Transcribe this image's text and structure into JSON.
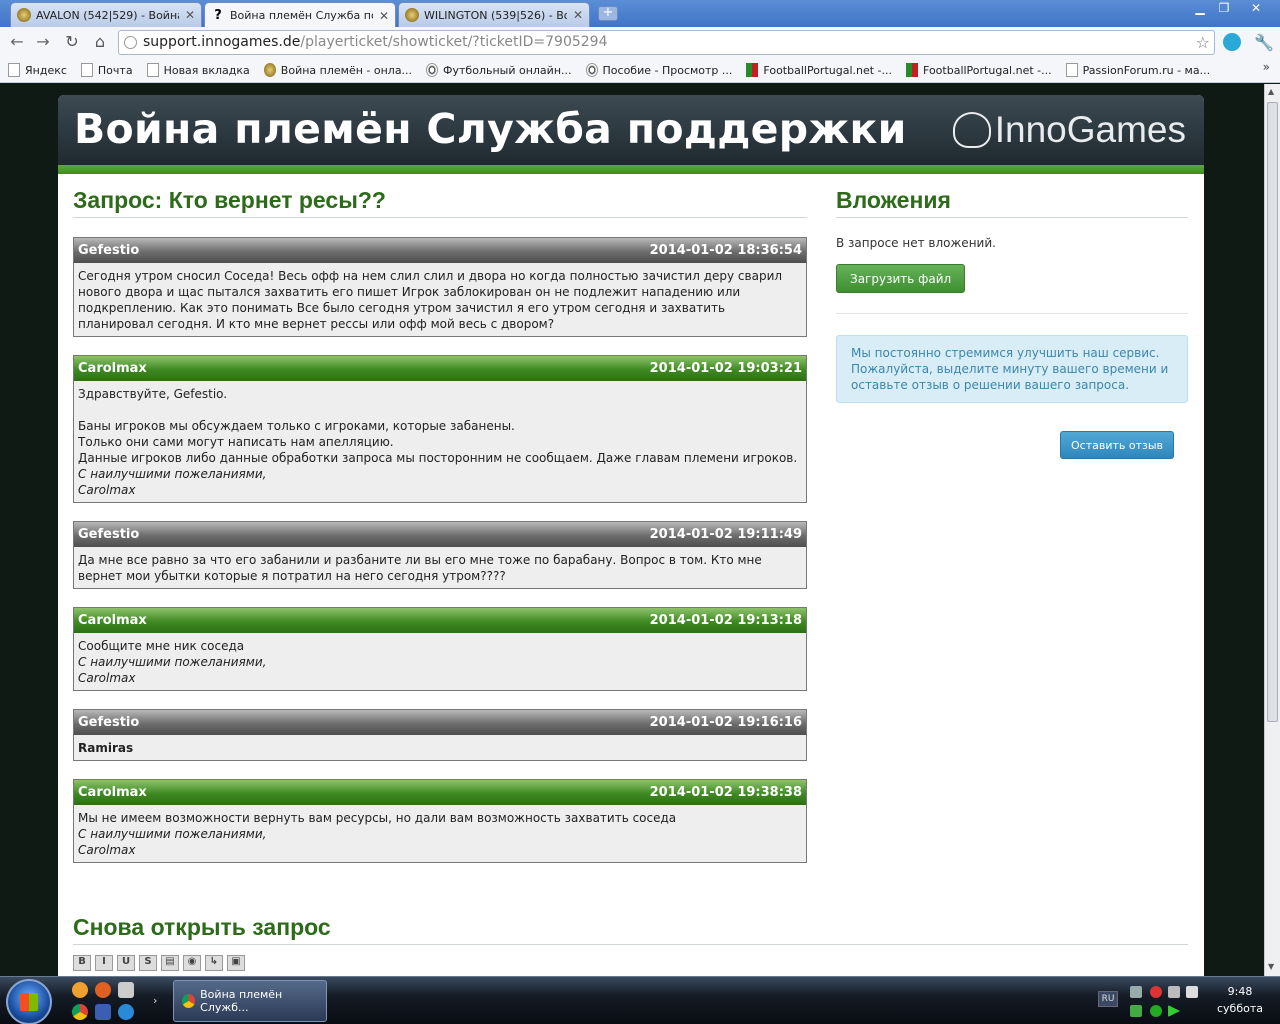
{
  "browser": {
    "tabs": [
      {
        "title": "AVALON (542|529) - Война...",
        "active": false
      },
      {
        "title": "Война племён Служба по...",
        "active": true
      },
      {
        "title": "WILINGTON (539|526) - Во...",
        "active": false
      }
    ],
    "url_host": "support.innogames.de",
    "url_path": "/playerticket/showticket/?ticketID=7905294",
    "bookmarks": [
      {
        "label": "Яндекс",
        "icon": "page-icon"
      },
      {
        "label": "Почта",
        "icon": "page-icon"
      },
      {
        "label": "Новая вкладка",
        "icon": "page-icon"
      },
      {
        "label": "Война племён - онла...",
        "icon": "tribalwars-icon"
      },
      {
        "label": "Футбольный онлайн...",
        "icon": "football-icon"
      },
      {
        "label": "Пособие - Просмотр ...",
        "icon": "football-icon"
      },
      {
        "label": "FootballPortugal.net -...",
        "icon": "fp-icon"
      },
      {
        "label": "FootballPortugal.net -...",
        "icon": "fp-icon"
      },
      {
        "label": "PassionForum.ru - ма...",
        "icon": "page-icon"
      }
    ],
    "bookmarks_more": "»"
  },
  "site": {
    "brand": "Война племён Служба поддержки",
    "logo": "InnoGames"
  },
  "ticket": {
    "title": "Запрос: Кто вернет ресы??",
    "messages": [
      {
        "author": "Gefestio",
        "role": "player",
        "date": "2014-01-02 18:36:54",
        "text": "Сегодня утром сносил Соседа! Весь офф на нем слил слил и двора но когда полностью зачистил деру сварил нового двора и щас пытался захватить его пишет Игрок заблокирован он не подлежит нападению или подкреплению. Как это понимать Все было сегодня утром зачистил я его утром сегодня и захватить планировал сегодня. И кто мне вернет рессы или офф мой весь с двором?",
        "signature": ""
      },
      {
        "author": "Carolmax",
        "role": "support",
        "date": "2014-01-02 19:03:21",
        "text": "Здравствуйте, Gefestio.\n\nБаны игроков мы обсуждаем только с игроками, которые забанены.\nТолько они сами могут написать нам апелляцию.\nДанные игроков либо данные обработки запроса мы посторонним не сообщаем. Даже главам племени игроков.\n",
        "signature": "С наилучшими пожеланиями,\nCarolmax"
      },
      {
        "author": "Gefestio",
        "role": "player",
        "date": "2014-01-02 19:11:49",
        "text": "Да мне все равно за что его забанили и разбаните ли вы его мне тоже по барабану. Вопрос в том. Кто мне вернет мои убытки которые я потратил на него сегодня утром????",
        "signature": ""
      },
      {
        "author": "Carolmax",
        "role": "support",
        "date": "2014-01-02 19:13:18",
        "text": "Сообщите мне ник соседа\n",
        "signature": "С наилучшими пожеланиями,\nCarolmax"
      },
      {
        "author": "Gefestio",
        "role": "player",
        "date": "2014-01-02 19:16:16",
        "text": "Ramiras",
        "signature": "",
        "bold": true
      },
      {
        "author": "Carolmax",
        "role": "support",
        "date": "2014-01-02 19:38:38",
        "text": "Мы не имеем возможности вернуть вам ресурсы, но дали вам возможность захватить соседа\n",
        "signature": "С наилучшими пожеланиями,\nCarolmax"
      }
    ],
    "reopen_title": "Снова открыть запрос",
    "editor_buttons": [
      "B",
      "I",
      "U",
      "S",
      "▤",
      "◉",
      "↳",
      "▣"
    ]
  },
  "sidebar": {
    "attachments_title": "Вложения",
    "no_attachments": "В запросе нет вложений.",
    "upload_button": "Загрузить файл",
    "feedback_info": "Мы постоянно стремимся улучшить наш сервис. Пожалуйста, выделите минуту вашего времени и оставьте отзыв о решении вашего запроса.",
    "feedback_button": "Оставить отзыв"
  },
  "taskbar": {
    "task_title": "Война племён Служб...",
    "language": "RU",
    "time": "9:48",
    "day": "суббота"
  },
  "colors": {
    "support_header": "#3f8a22",
    "player_header": "#6d6d6d",
    "heading": "#2d6a1a",
    "banner": "#2a363c"
  }
}
